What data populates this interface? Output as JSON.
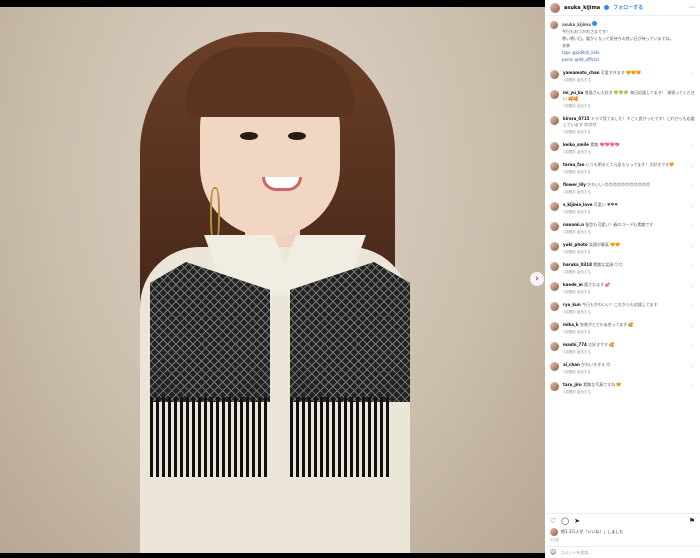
{
  "post": {
    "username": "asuka_kijima",
    "follow_label": "フォローする",
    "more": "⋯",
    "nav_next": "›",
    "caption_username": "asuka_kijima",
    "caption_lines": [
      "今日もおつかれさまです！",
      "寒い寒い日。暖かくなって気持ちの良い日が待っていますね。",
      "衣装",
      "tops @jaditch_kids",
      "pants @dd_official"
    ]
  },
  "comments": [
    {
      "user": "yamamoto_chan",
      "text": "可愛すぎます 🧡🧡🧡",
      "meta": "1週間前 返信する"
    },
    {
      "user": "mi_yu_ka",
      "text": "鬼島さん大好き 🍀🍀🍀 毎日応援してます！ 頑張ってください 🥰🥰",
      "meta": "1週間前 返信する"
    },
    {
      "user": "kirara_0715",
      "text": "ドラマ見てました！すごく良かったです！これからも応援しています 😍😍😍",
      "meta": "1週間前 返信する"
    },
    {
      "user": "keiko_smile",
      "text": "素敵 💖💖💖💖",
      "meta": "1週間前 返信する"
    },
    {
      "user": "tarou_fan",
      "text": "いつも明るくて元気もらってます！大好きです🧡",
      "meta": "1週間前 返信する"
    },
    {
      "user": "flower_lily",
      "text": "かわいい 😍😍😍😍😍😍😍😍😍😍😍",
      "meta": "1週間前 返信する"
    },
    {
      "user": "s_kijima_love",
      "text": "可愛い ♥♥♥",
      "meta": "1週間前 返信する"
    },
    {
      "user": "nanami.n",
      "text": "髪型も可愛い！春のコーデも素敵です",
      "meta": "1週間前 返信する"
    },
    {
      "user": "yuki_photo",
      "text": "笑顔が最高 🧡🧡",
      "meta": "1週間前 返信する"
    },
    {
      "user": "haruka_0318",
      "text": "素敵な笑顔 😊😊",
      "meta": "1週間前 返信する"
    },
    {
      "user": "kaede_m",
      "text": "癒されます 💕",
      "meta": "1週間前 返信する"
    },
    {
      "user": "ryo_kun",
      "text": "今日もかわいい！これからも応援してます",
      "meta": "1週間前 返信する"
    },
    {
      "user": "mika_k",
      "text": "衣装がとても似合ってます 🥰",
      "meta": "1週間前 返信する"
    },
    {
      "user": "mashi_774",
      "text": "大好きです 🥰",
      "meta": "1週間前 返信する"
    },
    {
      "user": "ai_chan",
      "text": "かわいすぎる 😍",
      "meta": "1週間前 返信する"
    },
    {
      "user": "taro_jiro",
      "text": "素敵な写真ですね 🧡",
      "meta": "1週間前 返信する"
    }
  ],
  "actions": {
    "like_icon": "heart-icon",
    "comment_icon": "comment-icon",
    "share_icon": "share-icon",
    "save_icon": "bookmark-icon",
    "likes_text": "他1.3万人が「いいね！」しました",
    "date": "3日前"
  },
  "composer": {
    "placeholder": "コメントを追加..."
  }
}
